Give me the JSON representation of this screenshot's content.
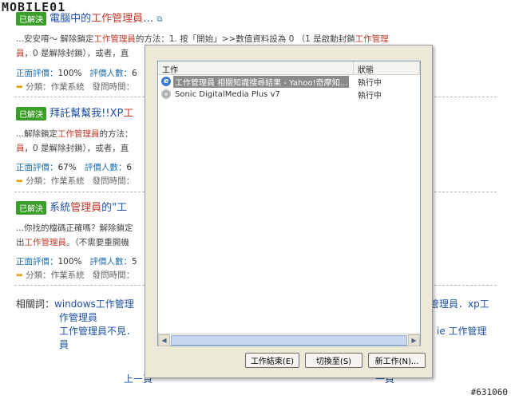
{
  "watermark": {
    "logo": "MOBILE01",
    "id": "#631060"
  },
  "results": [
    {
      "status": "已解決",
      "title_pre": "電腦中的",
      "title_hl": "工作管理員",
      "title_post": "…",
      "snippet1_a": "...安安唷～ 解除鎖定",
      "snippet1_hl": "工作管理員",
      "snippet1_b": "的方法：1. 按「開始」>>數值資料設為 0 （1 是啟動封鎖",
      "snippet1_hl2": "工作管理",
      "snippet2_hl": "員",
      "snippet2_b": "，0 是解除封鎖），或者，直",
      "rating_label": "正面評價：",
      "rating_value": "100%",
      "voters_label": "評價人數：",
      "voters_value": "6",
      "category": "分類：作業系統",
      "time_label": "發問時間："
    },
    {
      "status": "已解決",
      "title_pre": "拜託幫幫我!!XP",
      "title_hl": "工",
      "title_post": "",
      "snippet1_a": "...解除鎖定",
      "snippet1_hl": "工作管理員",
      "snippet1_b": "的方法：",
      "snippet1_hl2": "",
      "snippet2_hl": "員",
      "snippet2_b": "，0 是解除封鎖），或者，直",
      "rating_label": "正面評價：",
      "rating_value": "67%",
      "voters_label": "評價人數：",
      "voters_value": "6",
      "category": "分類：作業系統",
      "time_label": "發問時間："
    },
    {
      "status": "已解決",
      "title_pre": "系統",
      "title_hl": "管理員",
      "title_post": "的\"工",
      "snippet1_a": "...你找的檔碼正確嗎？解除鎖定",
      "snippet1_hl": "",
      "snippet1_b": "",
      "snippet1_hl2": "",
      "snippet2_pre": "出",
      "snippet2_hl": "工作管理員",
      "snippet2_b": "。（不需要重開機",
      "rating_label": "正面評價：",
      "rating_value": "100%",
      "voters_label": "評價人數：",
      "voters_value": "5",
      "category": "分類：作業系統",
      "time_label": "發問時間："
    }
  ],
  "related": {
    "label": "相關詞：",
    "line1_link": "windows工作管理",
    "line1_right": "管理員．xp工",
    "line2": "作管理員",
    "line3_left": "工作管理員不見．",
    "line3_right": "ie 工作管理",
    "line4": "員"
  },
  "pager": {
    "prev": "上一頁",
    "next": "一頁"
  },
  "dialog": {
    "col_task": "工作",
    "col_status": "狀態",
    "tasks": [
      {
        "name": "工作管理員 相關知識搜尋結果 - Yahoo!奇摩知...",
        "status": "執行中",
        "icon": "ie-icon",
        "selected": true
      },
      {
        "name": "Sonic DigitalMedia Plus v7",
        "status": "執行中",
        "icon": "sonic-icon",
        "selected": false
      }
    ],
    "buttons": {
      "end_task": "工作結束(E)",
      "switch_to": "切換至(S)",
      "new_task": "新工作(N)..."
    }
  }
}
